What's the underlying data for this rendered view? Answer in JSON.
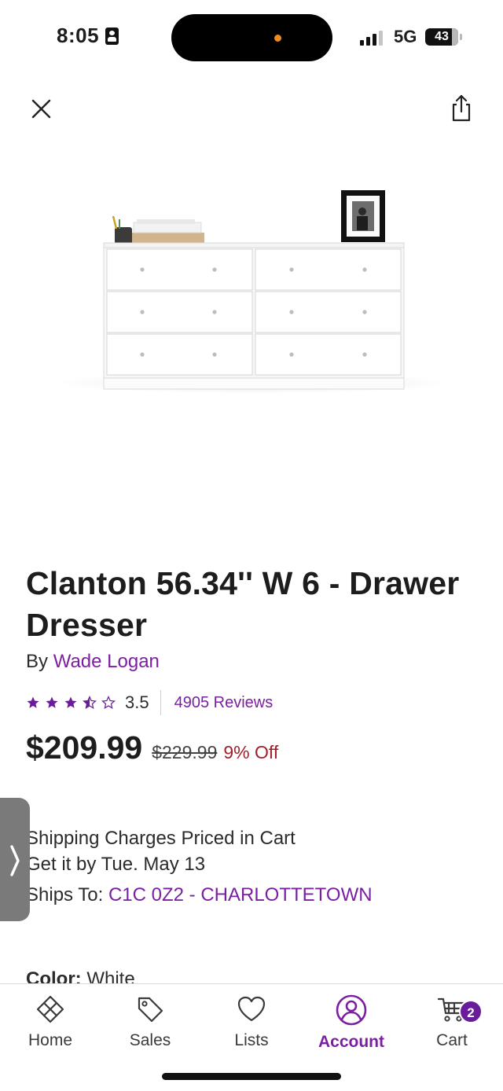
{
  "status_bar": {
    "time": "8:05",
    "network": "5G",
    "battery": "43"
  },
  "product": {
    "title": "Clanton 56.34'' W 6 - Drawer Dresser",
    "by_prefix": "By",
    "brand": "Wade Logan",
    "rating": "3.5",
    "rating_value": 3.5,
    "reviews": "4905 Reviews",
    "price": "$209.99",
    "original_price": "$229.99",
    "discount": "9% Off"
  },
  "shipping": {
    "charges": "Shipping Charges Priced in Cart",
    "delivery": "Get it by Tue. May 13",
    "ships_to_label": "Ships To:",
    "ships_to_value": "C1C 0Z2 - CHARLOTTETOWN"
  },
  "color": {
    "label": "Color:",
    "value": "White"
  },
  "nav": {
    "items": [
      {
        "label": "Home",
        "icon": "home-icon"
      },
      {
        "label": "Sales",
        "icon": "tag-icon"
      },
      {
        "label": "Lists",
        "icon": "heart-icon"
      },
      {
        "label": "Account",
        "icon": "account-icon"
      },
      {
        "label": "Cart",
        "icon": "cart-icon"
      }
    ],
    "active": "Account",
    "cart_count": "2"
  },
  "colors": {
    "accent": "#7b1fa2",
    "discount": "#a11f2a",
    "badge": "#6a1b9a"
  }
}
